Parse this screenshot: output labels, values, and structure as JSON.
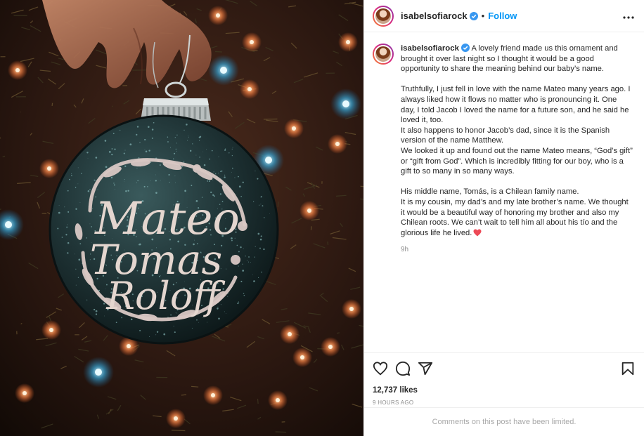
{
  "post": {
    "username": "isabelsofiarock",
    "follow_label": "Follow",
    "dot": "•",
    "more_icon": "more-horizontal-icon",
    "ornament_text": [
      "Mateo",
      "Tomas",
      "Roloff"
    ]
  },
  "caption": {
    "username": "isabelsofiarock",
    "para1": " A lovely friend made us this ornament and brought it over last night so I thought it would be a good opportunity to share the meaning behind our baby’s name.",
    "para2": "Truthfully, I just fell in love with the name Mateo many years ago. I always liked how it flows no matter who is pronouncing it. One day, I told Jacob I loved the name for a future son, and he said he loved it, too.",
    "para3": "It also happens to honor Jacob’s dad, since it is the Spanish version of the name Matthew.",
    "para4": "We looked it up and found out the name Mateo means, “God’s gift” or “gift from God”. Which is incredibly fitting for our boy, who is a gift to so many in so many ways.",
    "para5": "His middle name, Tomás, is a Chilean family name.",
    "para6": "It is my cousin, my dad’s and my late brother’s name. We thought it would be a beautiful way of honoring my brother and also my Chilean roots. We can’t wait to tell him all about his tío and the glorious life he lived.",
    "time": "9h"
  },
  "actions": {
    "likes": "12,737 likes",
    "ago": "9 HOURS AGO",
    "icons": [
      "heart-icon",
      "comment-icon",
      "share-icon",
      "bookmark-icon"
    ]
  },
  "footer": {
    "limited": "Comments on this post have been limited."
  },
  "colors": {
    "accent": "#0095f6",
    "verified": "#3897f0",
    "heart": "#ed4956"
  }
}
